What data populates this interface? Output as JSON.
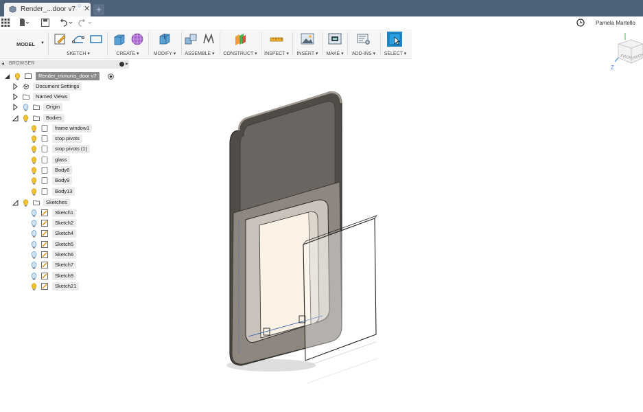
{
  "tab": {
    "title": "Render_...door v7"
  },
  "header": {
    "user_name": "Pamela Martello"
  },
  "toolbar": {
    "workspace": "MODEL",
    "groups": [
      {
        "label": "SKETCH ▾"
      },
      {
        "label": "CREATE ▾"
      },
      {
        "label": "MODIFY ▾"
      },
      {
        "label": "ASSEMBLE ▾"
      },
      {
        "label": "CONSTRUCT ▾"
      },
      {
        "label": "INSPECT ▾"
      },
      {
        "label": "INSERT ▾"
      },
      {
        "label": "MAKE ▾"
      },
      {
        "label": "ADD-INS ▾"
      },
      {
        "label": "SELECT ▾"
      }
    ]
  },
  "browser": {
    "title": "BROWSER",
    "root": "Render_mirrunis_door v7",
    "items": [
      {
        "label": "Document Settings"
      },
      {
        "label": "Named Views"
      },
      {
        "label": "Origin"
      },
      {
        "label": "Bodies"
      }
    ],
    "bodies": [
      {
        "label": "frame window1"
      },
      {
        "label": "stop pivots"
      },
      {
        "label": "stop pivots (1)"
      },
      {
        "label": "glass"
      },
      {
        "label": "Body8"
      },
      {
        "label": "Body9"
      },
      {
        "label": "Body13"
      }
    ],
    "sketches_label": "Sketches",
    "sketches": [
      {
        "label": "Sketch1"
      },
      {
        "label": "Sketch2"
      },
      {
        "label": "Sketch4"
      },
      {
        "label": "Sketch5"
      },
      {
        "label": "Sketch6"
      },
      {
        "label": "Sketch7"
      },
      {
        "label": "Sketch9"
      },
      {
        "label": "Sketch21"
      }
    ]
  },
  "viewcube": {
    "front": "FRONT",
    "right": "RIGHT",
    "axis_z": "Z"
  },
  "colors": {
    "titlebar": "#4d6179",
    "accent": "#1e88c8",
    "bulb": "#f1c232"
  }
}
